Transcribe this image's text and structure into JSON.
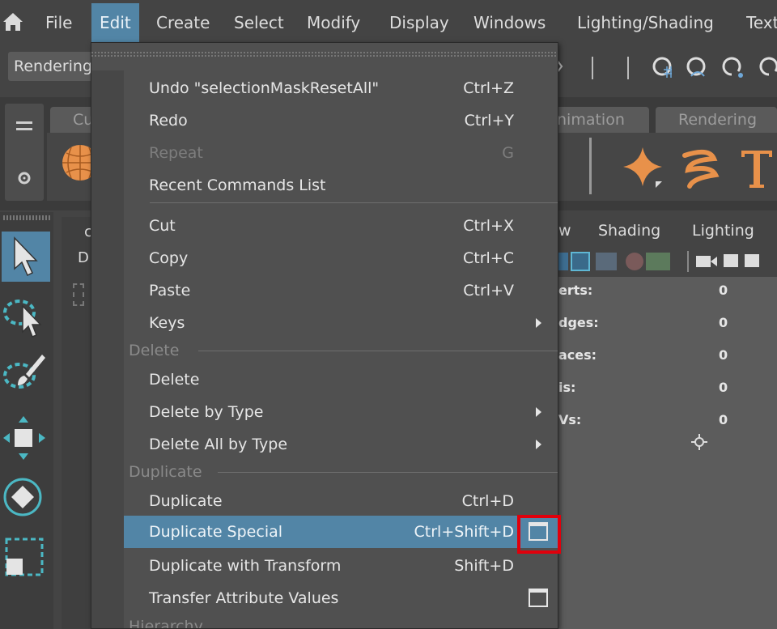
{
  "menubar": {
    "items": [
      {
        "label": "File",
        "active": false
      },
      {
        "label": "Edit",
        "active": true
      },
      {
        "label": "Create",
        "active": false
      },
      {
        "label": "Select",
        "active": false
      },
      {
        "label": "Modify",
        "active": false
      },
      {
        "label": "Display",
        "active": false
      },
      {
        "label": "Windows",
        "active": false
      },
      {
        "label": "Lighting/Shading",
        "active": false
      },
      {
        "label": "Text",
        "active": false
      }
    ]
  },
  "status_line": {
    "mode": "Rendering"
  },
  "shelf": {
    "tabs": [
      "Cu",
      "nimation",
      "Rendering"
    ]
  },
  "viewport": {
    "menus": [
      "w",
      "Shading",
      "Lighting"
    ],
    "hud": [
      {
        "label": "erts:",
        "value": "0"
      },
      {
        "label": "dges:",
        "value": "0"
      },
      {
        "label": "aces:",
        "value": "0"
      },
      {
        "label": "is:",
        "value": "0"
      },
      {
        "label": "Vs:",
        "value": "0"
      }
    ],
    "left_panel_labels": [
      "c",
      "D"
    ]
  },
  "edit_menu": {
    "items": {
      "undo": {
        "label": "Undo \"selectionMaskResetAll\"",
        "shortcut": "Ctrl+Z"
      },
      "redo": {
        "label": "Redo",
        "shortcut": "Ctrl+Y"
      },
      "repeat": {
        "label": "Repeat",
        "shortcut": "G"
      },
      "recent": {
        "label": "Recent Commands List",
        "shortcut": ""
      },
      "cut": {
        "label": "Cut",
        "shortcut": "Ctrl+X"
      },
      "copy": {
        "label": "Copy",
        "shortcut": "Ctrl+C"
      },
      "paste": {
        "label": "Paste",
        "shortcut": "Ctrl+V"
      },
      "keys": {
        "label": "Keys",
        "shortcut": ""
      },
      "delete": {
        "label": "Delete",
        "shortcut": ""
      },
      "delete_by_type": {
        "label": "Delete by Type",
        "shortcut": ""
      },
      "delete_all_by_type": {
        "label": "Delete All by Type",
        "shortcut": ""
      },
      "duplicate": {
        "label": "Duplicate",
        "shortcut": "Ctrl+D"
      },
      "duplicate_special": {
        "label": "Duplicate Special",
        "shortcut": "Ctrl+Shift+D"
      },
      "duplicate_with_transform": {
        "label": "Duplicate with Transform",
        "shortcut": "Shift+D"
      },
      "transfer_attribute_values": {
        "label": "Transfer Attribute Values",
        "shortcut": ""
      }
    },
    "sections": {
      "delete": "Delete",
      "duplicate": "Duplicate",
      "hierarchy": "Hierarchy"
    }
  },
  "colors": {
    "highlight": "#5285a6",
    "annotation": "#e0000c",
    "accent_orange": "#e8914a"
  }
}
